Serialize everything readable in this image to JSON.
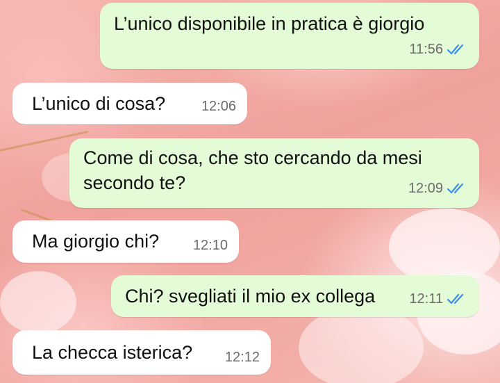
{
  "colors": {
    "outgoing_bubble": "#e3fbd6",
    "incoming_bubble": "#ffffff",
    "read_tick": "#3d8ee8",
    "timestamp": "#6b6b6b"
  },
  "messages": [
    {
      "id": "m1",
      "direction": "outgoing",
      "text": "L’unico disponibile in pratica è giorgio",
      "time": "11:56",
      "status_icon": "double-check-read-icon"
    },
    {
      "id": "m2",
      "direction": "incoming",
      "text": "L’unico di cosa?",
      "time": "12:06"
    },
    {
      "id": "m3",
      "direction": "outgoing",
      "text_lines": [
        "Come di cosa, che sto cercando da mesi",
        "secondo te?"
      ],
      "time": "12:09",
      "status_icon": "double-check-read-icon"
    },
    {
      "id": "m4",
      "direction": "incoming",
      "text": "Ma giorgio chi?",
      "time": "12:10"
    },
    {
      "id": "m5",
      "direction": "outgoing",
      "text": "Chi? svegliati il mio ex collega",
      "time": "12:11",
      "status_icon": "double-check-read-icon"
    },
    {
      "id": "m6",
      "direction": "incoming",
      "text": "La checca isterica?",
      "time": "12:12"
    }
  ]
}
